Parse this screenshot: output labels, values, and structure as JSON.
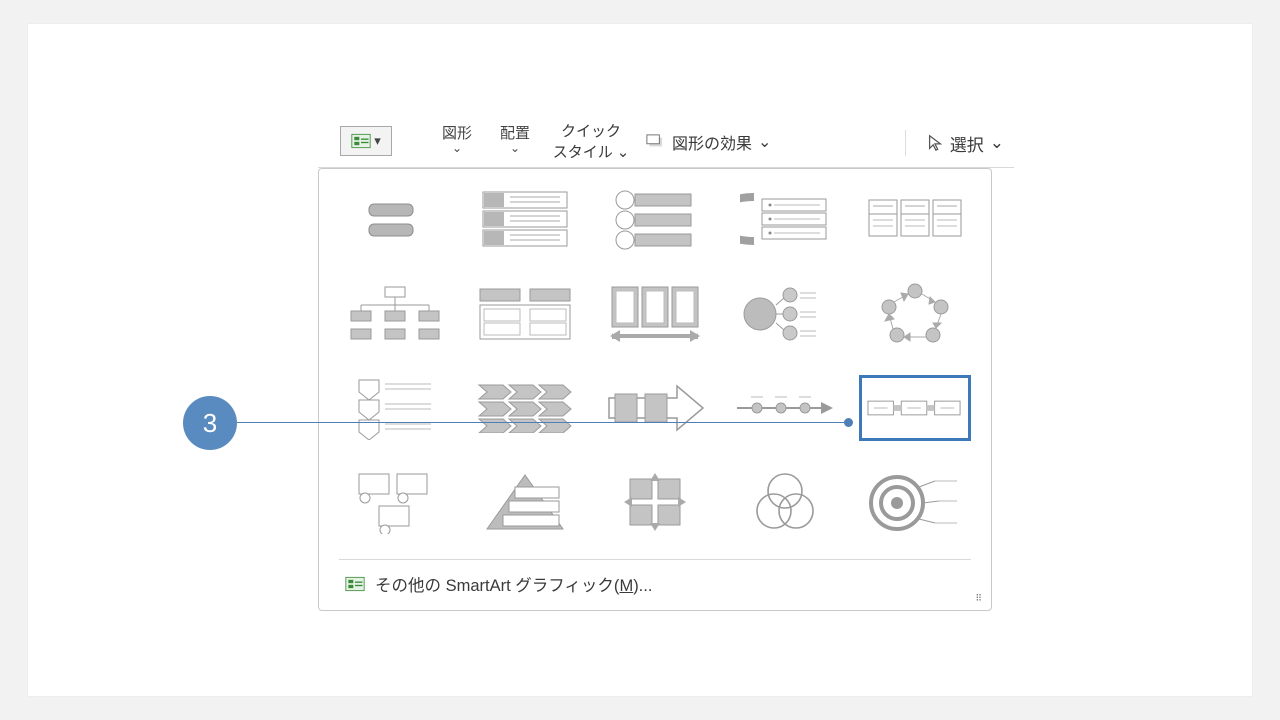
{
  "ribbon": {
    "shapes": "図形",
    "arrange": "配置",
    "quick_top": "クイック",
    "quick_bottom": "スタイル",
    "shape_effects": "図形の効果",
    "select": "選択"
  },
  "gallery": {
    "rows": [
      [
        "basic-block-list",
        "vertical-box-list",
        "vertical-bullet-list",
        "table-list",
        "horizontal-picture-list"
      ],
      [
        "hierarchy",
        "grouped-list",
        "vertical-process",
        "radial-list",
        "cycle"
      ],
      [
        "step-down-process",
        "arrow-ribbon",
        "basic-process",
        "accent-process",
        "continuous-block-process"
      ],
      [
        "picture-org-chart",
        "pyramid-list",
        "matrix",
        "venn",
        "target-list"
      ]
    ],
    "selected": "continuous-block-process",
    "more_label_pre": "その他の SmartArt グラフィック(",
    "more_mnemonic": "M",
    "more_label_post": ")..."
  },
  "callout": {
    "number": "3"
  }
}
